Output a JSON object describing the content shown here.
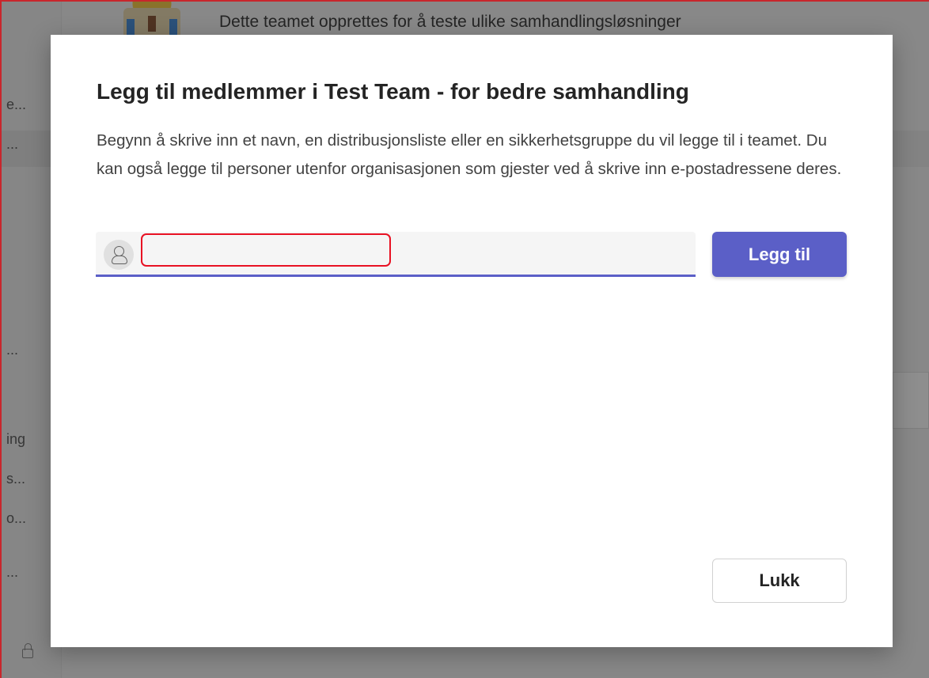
{
  "background": {
    "team_description": "Dette teamet opprettes for å teste ulike samhandlingsløsninger",
    "sidebar_fragments": [
      "e...",
      "...",
      "...",
      "ing",
      "s...",
      "o...",
      "..."
    ]
  },
  "dialog": {
    "title": "Legg til medlemmer i Test Team - for bedre samhandling",
    "description": "Begynn å skrive inn et navn, en distribusjonsliste eller en sikkerhetsgruppe du vil legge til i teamet. Du kan også legge til personer utenfor organisasjonen som gjester ved å skrive inn e-postadressene deres.",
    "input": {
      "value": "",
      "placeholder": ""
    },
    "add_label": "Legg til",
    "close_label": "Lukk"
  },
  "colors": {
    "accent": "#5b5fc7",
    "highlight_border": "#e81123"
  }
}
